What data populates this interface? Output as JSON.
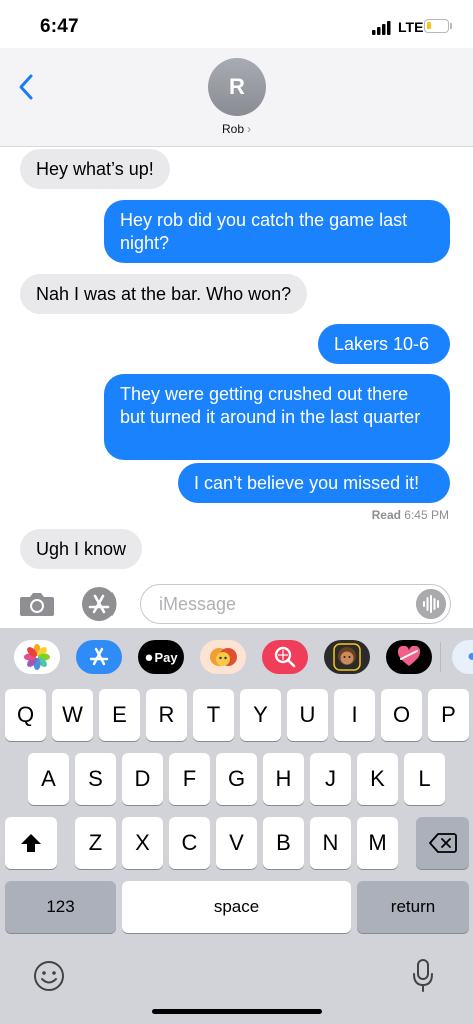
{
  "status_bar": {
    "time": "6:47",
    "network": "LTE"
  },
  "header": {
    "avatar_initial": "R",
    "contact_name": "Rob",
    "contact_chevron": "›"
  },
  "messages": [
    {
      "text": "Hey what’s up!",
      "direction": "incoming"
    },
    {
      "text": "Hey rob did you catch the game last night?",
      "direction": "outgoing"
    },
    {
      "text": "Nah I was at the bar. Who won?",
      "direction": "incoming"
    },
    {
      "text": "Lakers 10-6",
      "direction": "outgoing"
    },
    {
      "text": "They were getting crushed out there but turned it around in the last quarter",
      "direction": "outgoing"
    },
    {
      "text": "I can’t believe you missed it!",
      "direction": "outgoing"
    },
    {
      "text": "Ugh I know",
      "direction": "incoming"
    }
  ],
  "read_receipt": {
    "label": "Read",
    "time": "6:45 PM"
  },
  "composer": {
    "placeholder": "iMessage",
    "value": ""
  },
  "app_strip": [
    {
      "name": "photos-app-icon"
    },
    {
      "name": "app-store-icon"
    },
    {
      "name": "apple-pay-icon",
      "label": "Pay"
    },
    {
      "name": "memoji-stickers-icon"
    },
    {
      "name": "image-search-icon"
    },
    {
      "name": "memoji-icon"
    },
    {
      "name": "digital-touch-icon"
    }
  ],
  "keyboard": {
    "row1": [
      "Q",
      "W",
      "E",
      "R",
      "T",
      "Y",
      "U",
      "I",
      "O",
      "P"
    ],
    "row2": [
      "A",
      "S",
      "D",
      "F",
      "G",
      "H",
      "J",
      "K",
      "L"
    ],
    "row3": [
      "Z",
      "X",
      "C",
      "V",
      "B",
      "N",
      "M"
    ],
    "numbers_key": "123",
    "space_key": "space",
    "return_key": "return"
  },
  "colors": {
    "outgoing_bubble": "#1982fc",
    "incoming_bubble": "#e9e9eb",
    "accent": "#1a7cf5",
    "keyboard_bg": "#d1d3d9"
  }
}
